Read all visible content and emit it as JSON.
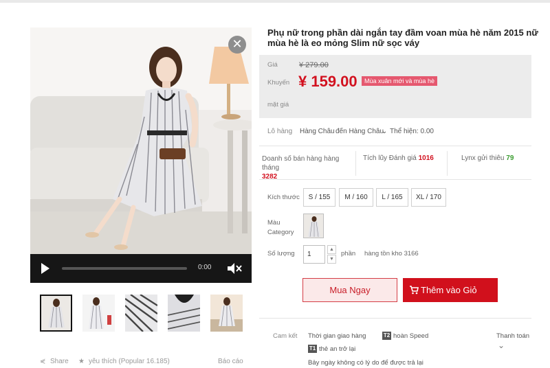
{
  "gallery": {
    "video_time": "0:00",
    "thumbnails": [
      {
        "alt": "thumb-1"
      },
      {
        "alt": "thumb-2"
      },
      {
        "alt": "thumb-3"
      },
      {
        "alt": "thumb-4"
      },
      {
        "alt": "thumb-5"
      }
    ],
    "share_label": "Share",
    "favorite_label": "yêu thích (Popular 16.185)",
    "report_label": "Báo cáo"
  },
  "product": {
    "title": "Phụ nữ trong phần dài ngắn tay đầm voan mùa hè năm 2015 nữ mùa hè là eo mỏng Slim nữ sọc váy",
    "price": {
      "label": "Giá",
      "old_price": "¥ 279.00",
      "promo_label": "Khuyến",
      "new_price": "¥ 159.00",
      "promo_tag": "Mùa xuân mới và mùa hè",
      "extra_label": "mặt giá"
    },
    "shipping": {
      "label": "Lô hàng",
      "from": "Hàng Châu",
      "to": "đến Hàng Châu",
      "show": "Thể hiện: 0.00"
    },
    "stats": {
      "monthly_sales_label": "Doanh số bán hàng hàng tháng",
      "monthly_sales": "3282",
      "reviews_label": "Tích lũy Đánh giá",
      "reviews": "1016",
      "lynx_label": "Lynx gửi thiêu",
      "lynx": "79"
    },
    "size_label": "Kích thước",
    "sizes": [
      "S / 155",
      "M / 160",
      "L / 165",
      "XL / 170"
    ],
    "color_label": "Màu Category",
    "quantity_label": "Số lượng",
    "quantity_value": "1",
    "quantity_unit": "phần",
    "stock": "hàng tồn kho 3166",
    "buy_now": "Mua Ngay",
    "add_to_cart": "Thêm vào Giỏ hàng"
  },
  "commitment": {
    "label": "Cam kết",
    "delivery": "Thời gian giao hàng",
    "speed": "hoàn Speed",
    "speed_icon": "T2",
    "safe_return": "thẻ an trở lại",
    "safe_icon": "T1",
    "seven_day": "Bảy ngày không có lý do để được trả lại",
    "payment": "Thanh toán"
  },
  "colors": {
    "accent": "#d1101c",
    "price_red": "#d2111f",
    "promo_pink": "#e5586f",
    "price_bg": "#ececec",
    "green": "#3a9c2f"
  }
}
